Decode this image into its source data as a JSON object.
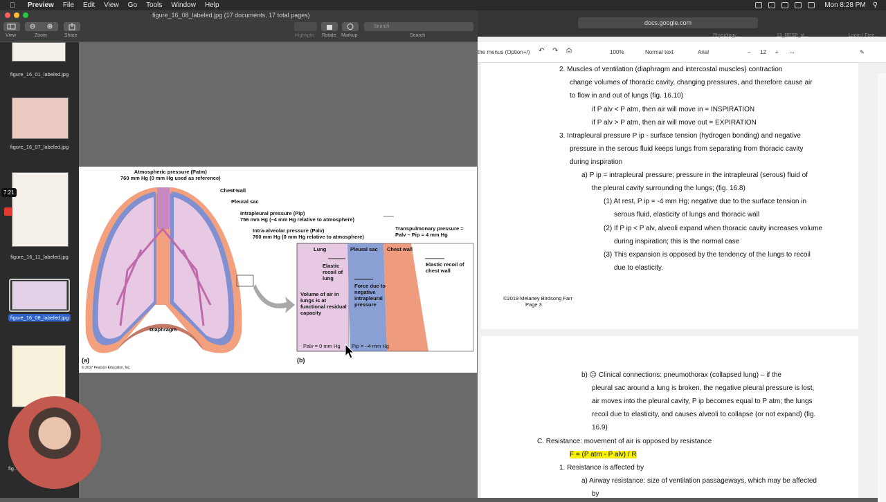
{
  "menubar": {
    "apple": "",
    "app": "Preview",
    "items": [
      "File",
      "Edit",
      "View",
      "Go",
      "Tools",
      "Window",
      "Help"
    ],
    "clock": "Mon 8:28 PM"
  },
  "preview": {
    "title": "figure_16_08_labeled.jpg (17 documents, 17 total pages)",
    "toolbar": {
      "view": "View",
      "zoom": "Zoom",
      "share": "Share",
      "highlight": "Highlight",
      "rotate": "Rotate",
      "markup": "Markup",
      "search_placeholder": "Search",
      "search_label": "Search"
    },
    "thumbnails": [
      {
        "name": "figure_16_01_labeled.jpg"
      },
      {
        "name": "figure_16_07_labeled.jpg"
      },
      {
        "name": "figure_16_11_labeled.jpg"
      },
      {
        "name": "figure_16_08_labeled.jpg"
      },
      {
        "name": "fig..."
      }
    ],
    "recording_timer": "7:21",
    "figure": {
      "atm_line1": "Atmospheric pressure (Patm)",
      "atm_line2": "760 mm Hg (0 mm Hg used as reference)",
      "chest_wall": "Chest wall",
      "pleural_sac": "Pleural sac",
      "intrapleural1": "Intrapleural pressure (Pip)",
      "intrapleural2": "756 mm Hg (–4 mm Hg relative to atmosphere)",
      "intraalv1": "Intra-alveolar pressure (Palv)",
      "intraalv2": "760 mm Hg (0 mm Hg relative to atmosphere)",
      "transpul1": "Transpulmonary pressure =",
      "transpul2": "Palv – Pip = 4 mm Hg",
      "diaphragm": "Diaphragm",
      "a": "(a)",
      "b": "(b)",
      "copyright": "© 2017 Pearson Education, Inc.",
      "col_lung": "Lung",
      "col_pleural": "Pleural sac",
      "col_chest": "Chest wall",
      "elastic_lung": "Elastic recoil of lung",
      "elastic_chest": "Elastic recoil of chest wall",
      "force": "Force due to negative intrapleural pressure",
      "volume": "Volume of air in lungs is at functional residual capacity",
      "palv": "Palv = 0 mm Hg",
      "pip": "Pip = –4 mm Hg"
    }
  },
  "browser": {
    "url": "docs.google.com",
    "tabs": [
      "Physiology...",
      "13_RESP_st...",
      "Loom | Free..."
    ],
    "menus_hint": "the menus (Option+/)",
    "zoom": "100%",
    "style": "Normal text",
    "font": "Arial",
    "size": "12"
  },
  "gdoc": {
    "lines": [
      "2.  Muscles of ventilation (diaphragm and intercostal muscles) contraction",
      "change volumes of thoracic cavity, changing pressures, and therefore cause air",
      "to flow in and out of lungs  (fig. 16.10)",
      "if P alv < P atm, then air will move in = INSPIRATION",
      "if P alv > P atm, then air will move out = EXPIRATION",
      "3.  Intrapleural pressure P ip - surface tension (hydrogen bonding) and negative",
      "pressure in the serous fluid keeps lungs from separating from thoracic cavity",
      "during inspiration",
      "a)   P ip = intrapleural pressure; pressure in the intrapleural (serous) fluid of",
      "the pleural cavity surrounding the lungs; (fig. 16.8)",
      "(1) At rest, P ip = -4 mm Hg; negative due to the surface tension in",
      "serous fluid, elasticity of lungs and thoracic wall",
      "(2) If P ip < P alv, alveoli expand when thoracic cavity increases volume",
      "during inspiration; this is the normal case",
      "(3) This expansion is opposed by the tendency of the lungs to recoil",
      "due to elasticity."
    ],
    "footer1": "©2019 Melaney Birdsong Farr",
    "footer2": "Page 3",
    "lines2": [
      "b)   ☹ Clinical connections: pneumothorax (collapsed lung) – if the",
      "pleural sac around a lung is broken, the negative pleural pressure is lost,",
      "air moves into the pleural cavity, P ip  becomes equal to P atm; the lungs",
      "recoil due to elasticity, and causes alveoli to collapse (or not expand) (fig.",
      "16.9)",
      "C.  Resistance: movement of air is opposed by resistance",
      "F = (P atm - P alv) / R",
      "1.   Resistance is affected by",
      "a)   Airway resistance: size of ventilation passageways, which may be affected",
      "by"
    ]
  },
  "colors": {
    "highlight": "#f8f200",
    "selection": "#2f62c8",
    "pleural": "#8a9fd4",
    "chest": "#ef9b7e",
    "lung": "#e7c9e3"
  }
}
